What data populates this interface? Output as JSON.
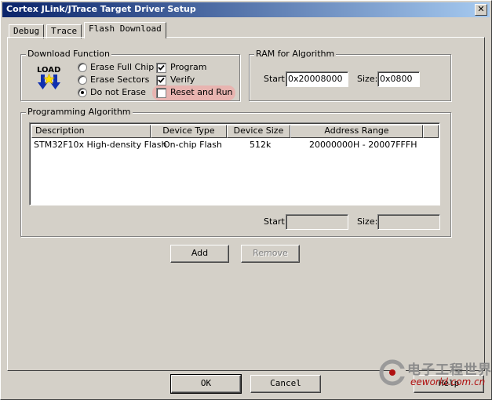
{
  "window": {
    "title": "Cortex JLink/JTrace Target Driver Setup",
    "close_glyph": "✕"
  },
  "tabs": [
    {
      "label": "Debug",
      "active": false
    },
    {
      "label": "Trace",
      "active": false
    },
    {
      "label": "Flash Download",
      "active": true
    }
  ],
  "download_function": {
    "title": "Download Function",
    "icon_text": "LOAD",
    "radios": [
      {
        "label": "Erase Full Chip",
        "selected": false
      },
      {
        "label": "Erase Sectors",
        "selected": false
      },
      {
        "label": "Do not Erase",
        "selected": true
      }
    ],
    "checkboxes": [
      {
        "label": "Program",
        "checked": true
      },
      {
        "label": "Verify",
        "checked": true
      },
      {
        "label": "Reset and Run",
        "checked": false,
        "highlighted": true
      }
    ],
    "highlight_color": "#e8b4b0"
  },
  "ram": {
    "title": "RAM for Algorithm",
    "start_label": "Start:",
    "start_value": "0x20008000",
    "size_label": "Size:",
    "size_value": "0x0800"
  },
  "programming": {
    "title": "Programming Algorithm",
    "columns": [
      "Description",
      "Device Type",
      "Device Size",
      "Address Range"
    ],
    "rows": [
      [
        "STM32F10x High-density Flash",
        "On-chip Flash",
        "512k",
        "20000000H - 20007FFFH"
      ]
    ],
    "start_label": "Start:",
    "start_value": "",
    "size_label": "Size:",
    "size_value": ""
  },
  "buttons": {
    "add": "Add",
    "remove": "Remove",
    "ok": "OK",
    "cancel": "Cancel",
    "help": "Help"
  },
  "watermark": {
    "cn": "电子工程世界",
    "en": "eeworld.com.cn"
  },
  "colors": {
    "titlebar_start": "#0a246a",
    "titlebar_end": "#a6caf0",
    "face": "#d4d0c8"
  }
}
